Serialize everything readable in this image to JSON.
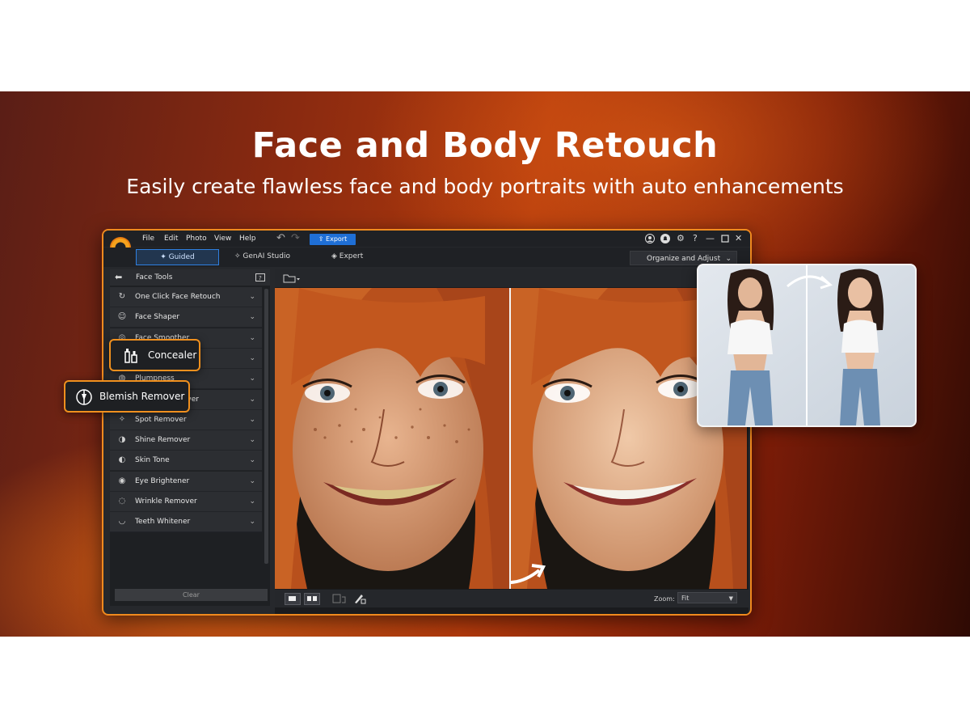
{
  "hero": {
    "title": "Face and Body Retouch",
    "subtitle": "Easily create flawless face and body portraits with auto enhancements"
  },
  "colors": {
    "accent_orange": "#f08a1e",
    "export_blue": "#1f6fd6",
    "guided_blue": "#2f7fe0",
    "window_bg": "#26282c"
  },
  "app": {
    "menu": [
      "File",
      "Edit",
      "Photo",
      "View",
      "Help"
    ],
    "export_label": "Export",
    "window_icons": [
      "account-icon",
      "notification-icon",
      "gear-icon",
      "help-icon",
      "minimize-icon",
      "maximize-icon",
      "close-icon"
    ],
    "help_glyph": "?",
    "modes": {
      "guided": "Guided",
      "genai": "GenAI Studio",
      "expert": "Expert"
    },
    "workspace_select": "Organize and Adjust"
  },
  "panel": {
    "title": "Face Tools",
    "tools": [
      {
        "label": "One Click Face Retouch",
        "icon": "refresh-face-icon"
      },
      {
        "label": "Face Shaper",
        "icon": "face-shaper-icon"
      },
      {
        "label": "Face Smoother",
        "icon": "face-smoother-icon"
      },
      {
        "label": "Concealer",
        "icon": "concealer-icon"
      },
      {
        "label": "Plumpness",
        "icon": "plumpness-icon"
      },
      {
        "label": "Blemish Remover",
        "icon": "blemish-icon"
      },
      {
        "label": "Spot Remover",
        "icon": "spot-icon"
      },
      {
        "label": "Shine Remover",
        "icon": "shine-icon"
      },
      {
        "label": "Skin Tone",
        "icon": "skin-tone-icon"
      },
      {
        "label": "Eye Brightener",
        "icon": "eye-icon"
      },
      {
        "label": "Wrinkle Remover",
        "icon": "wrinkle-icon"
      },
      {
        "label": "Teeth Whitener",
        "icon": "teeth-icon"
      }
    ],
    "clear_label": "Clear"
  },
  "canvas": {
    "zoom_label": "Zoom:",
    "zoom_value": "Fit"
  },
  "callouts": {
    "concealer": "Concealer",
    "blemish": "Blemish Remover"
  }
}
